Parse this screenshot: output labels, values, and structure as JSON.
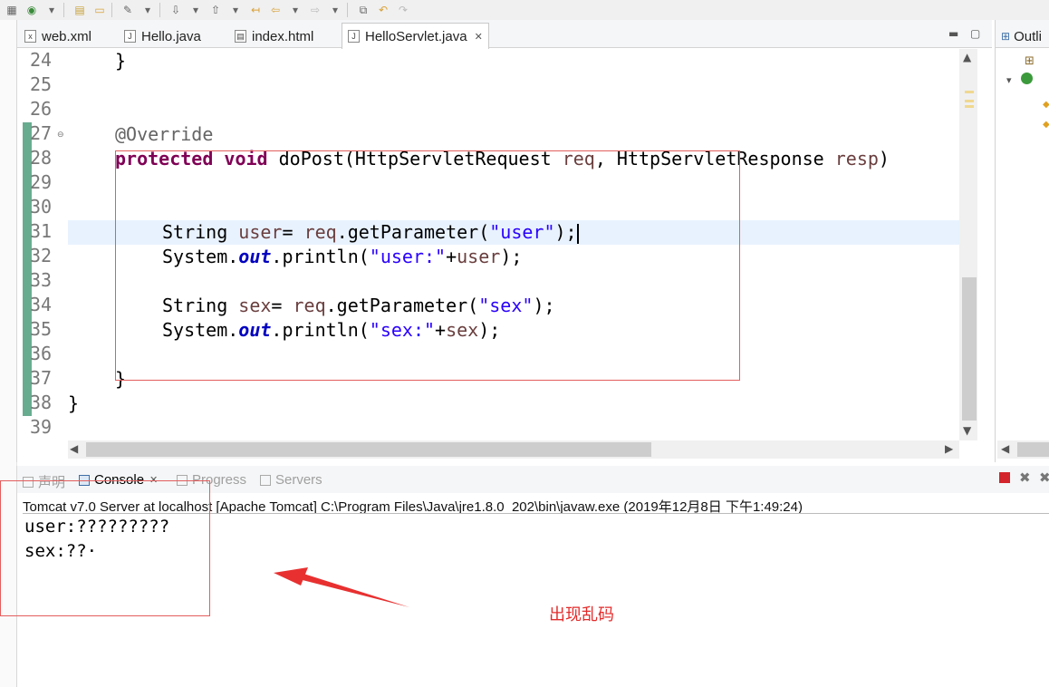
{
  "editor": {
    "tabs": [
      {
        "label": "web.xml",
        "icon": "xml-file-icon"
      },
      {
        "label": "Hello.java",
        "icon": "java-file-icon"
      },
      {
        "label": "index.html",
        "icon": "html-file-icon"
      },
      {
        "label": "HelloServlet.java",
        "icon": "java-file-icon",
        "active": true,
        "close": "✕"
      }
    ],
    "line_numbers": [
      "24",
      "25",
      "26",
      "27",
      "28",
      "29",
      "30",
      "31",
      "32",
      "33",
      "34",
      "35",
      "36",
      "37",
      "38",
      "39"
    ],
    "code": {
      "l24": "}",
      "l27_annotation": "@Override",
      "l28_kw1": "protected",
      "l28_kw2": "void",
      "l28_a": "doPost(HttpServletRequest ",
      "l28_req": "req",
      "l28_b": ", HttpServletResponse ",
      "l28_resp": "resp",
      "l28_c": ")",
      "l31_type": "String ",
      "l31_var": "user",
      "l31_eq": "= ",
      "l31_req": "req",
      "l31_call": ".getParameter(",
      "l31_str": "\"user\"",
      "l31_end": ");",
      "l32_a": "System.",
      "l32_out": "out",
      "l32_b": ".println(",
      "l32_str": "\"user:\"",
      "l32_plus": "+",
      "l32_var": "user",
      "l32_end": ");",
      "l34_type": "String ",
      "l34_var": "sex",
      "l34_eq": "= ",
      "l34_req": "req",
      "l34_call": ".getParameter(",
      "l34_str": "\"sex\"",
      "l34_end": ");",
      "l35_a": "System.",
      "l35_out": "out",
      "l35_b": ".println(",
      "l35_str": "\"sex:\"",
      "l35_plus": "+",
      "l35_var": "sex",
      "l35_end": ");",
      "l37": "}",
      "l38": "}"
    }
  },
  "outline": {
    "label": "Outli"
  },
  "console": {
    "tabs": [
      {
        "label": "声明",
        "dim": true
      },
      {
        "label": "Console",
        "close": "✕"
      },
      {
        "label": "Progress",
        "dim": true
      },
      {
        "label": "Servers",
        "dim": true
      }
    ],
    "description": "Tomcat v7.0 Server at localhost [Apache Tomcat] C:\\Program Files\\Java\\jre1.8.0_202\\bin\\javaw.exe (2019年12月8日 下午1:49:24)",
    "output": [
      "user:?????????",
      "sex:??·"
    ]
  },
  "annotation": {
    "text": "出现乱码",
    "color": "#e32b2b"
  },
  "colors": {
    "keyword": "#7f0055",
    "string": "#2a00ff",
    "field": "#0000c0",
    "variable": "#6a3e3e",
    "highlight": "#e8f2fe",
    "box": "#e35d5d"
  }
}
